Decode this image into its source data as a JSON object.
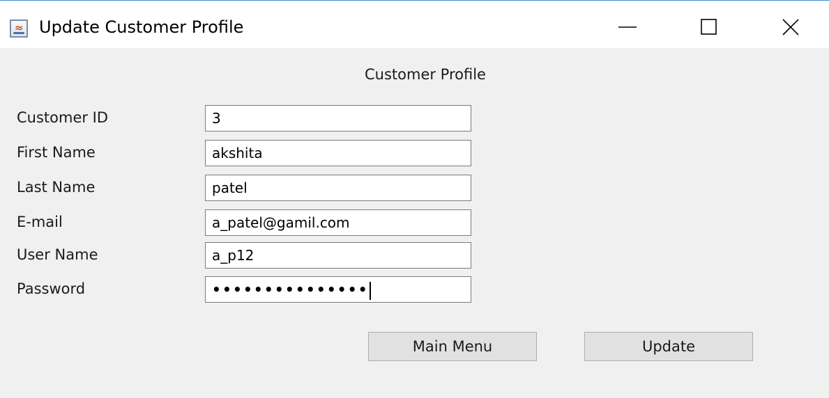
{
  "window": {
    "title": "Update Customer Profile",
    "icon": "java-cup-icon",
    "controls": {
      "minimize_icon": "minimize-icon",
      "maximize_icon": "maximize-icon",
      "close_icon": "close-icon"
    }
  },
  "form": {
    "heading": "Customer Profile",
    "fields": [
      {
        "label": "Customer ID",
        "value": "3"
      },
      {
        "label": "First Name",
        "value": "akshita"
      },
      {
        "label": "Last Name",
        "value": "patel"
      },
      {
        "label": "E-mail",
        "value": "a_patel@gamil.com"
      },
      {
        "label": "User Name",
        "value": "a_p12"
      },
      {
        "label": "Password",
        "value": "•••••••••••••••"
      }
    ]
  },
  "buttons": {
    "main_menu": "Main Menu",
    "update": "Update"
  },
  "colors": {
    "window_border": "#3c8bd6",
    "content_background": "#f0f0f0",
    "button_background": "#e1e1e1"
  }
}
